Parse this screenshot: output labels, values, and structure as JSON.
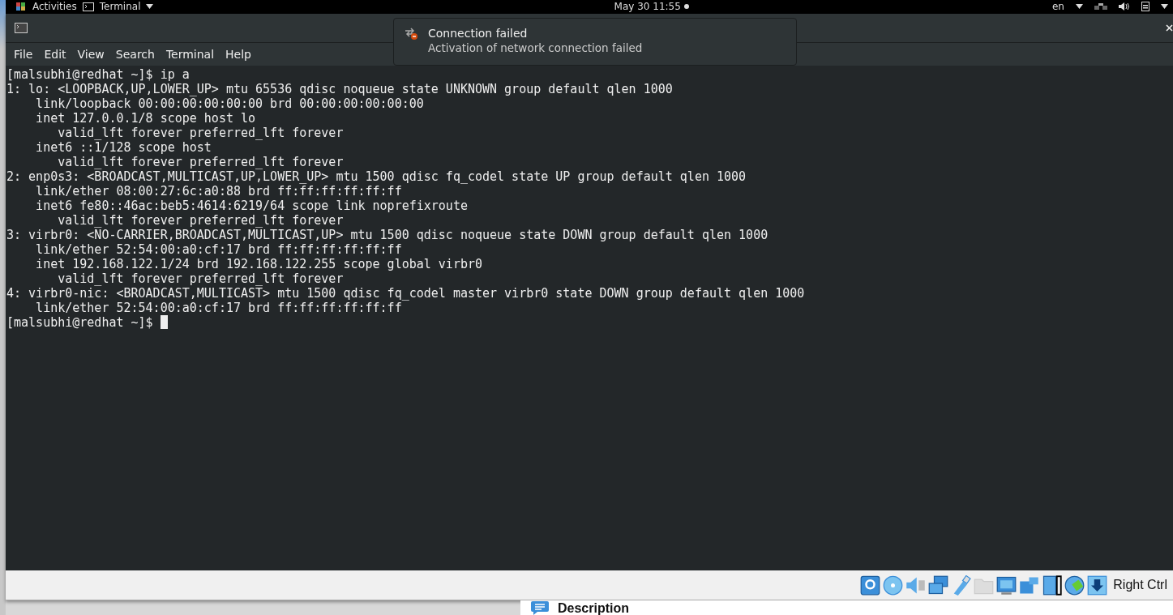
{
  "top_bar": {
    "activities": "Activities",
    "app_menu": "Terminal",
    "clock": "May 30  11:55",
    "language": "en"
  },
  "window": {
    "menu": [
      "File",
      "Edit",
      "View",
      "Search",
      "Terminal",
      "Help"
    ]
  },
  "terminal": {
    "lines": [
      "[malsubhi@redhat ~]$ ip a",
      "1: lo: <LOOPBACK,UP,LOWER_UP> mtu 65536 qdisc noqueue state UNKNOWN group default qlen 1000",
      "    link/loopback 00:00:00:00:00:00 brd 00:00:00:00:00:00",
      "    inet 127.0.0.1/8 scope host lo",
      "       valid_lft forever preferred_lft forever",
      "    inet6 ::1/128 scope host",
      "       valid_lft forever preferred_lft forever",
      "2: enp0s3: <BROADCAST,MULTICAST,UP,LOWER_UP> mtu 1500 qdisc fq_codel state UP group default qlen 1000",
      "    link/ether 08:00:27:6c:a0:88 brd ff:ff:ff:ff:ff:ff",
      "    inet6 fe80::46ac:beb5:4614:6219/64 scope link noprefixroute",
      "       valid_lft forever preferred_lft forever",
      "3: virbr0: <NO-CARRIER,BROADCAST,MULTICAST,UP> mtu 1500 qdisc noqueue state DOWN group default qlen 1000",
      "    link/ether 52:54:00:a0:cf:17 brd ff:ff:ff:ff:ff:ff",
      "    inet 192.168.122.1/24 brd 192.168.122.255 scope global virbr0",
      "       valid_lft forever preferred_lft forever",
      "4: virbr0-nic: <BROADCAST,MULTICAST> mtu 1500 qdisc fq_codel master virbr0 state DOWN group default qlen 1000",
      "    link/ether 52:54:00:a0:cf:17 brd ff:ff:ff:ff:ff:ff"
    ],
    "prompt": "[malsubhi@redhat ~]$"
  },
  "notification": {
    "title": "Connection failed",
    "body": "Activation of network connection failed"
  },
  "vm_status_bar": {
    "host_key": "Right Ctrl"
  },
  "host_page": {
    "heading": "Description"
  }
}
